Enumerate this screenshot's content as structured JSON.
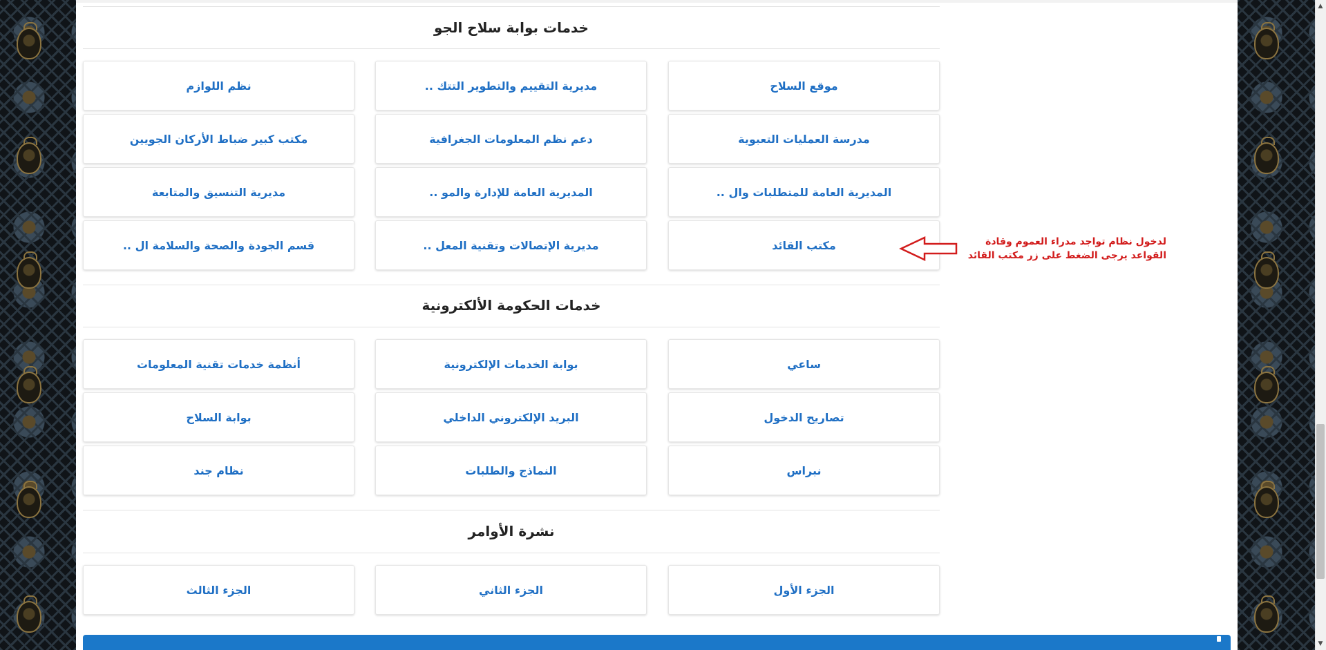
{
  "sections": [
    {
      "title": "خدمات بوابة سلاح الجو",
      "tiles": [
        "موقع السلاح",
        "مديرية التقييم والتطوير التتك ..",
        "نظم اللوازم",
        "مدرسة العمليات التعبوية",
        "دعم نظم المعلومات الجغرافية",
        "مكتب كبير ضباط الأركان الجويين",
        "المديرية العامة للمتطلبات وال ..",
        "المديرية العامة للإدارة والمو ..",
        "مديرية التنسيق والمتابعة",
        "مكتب القائد",
        "مديرية الإتصالات وتقنية المعل ..",
        "قسم الجودة والصحة والسلامة ال .."
      ]
    },
    {
      "title": "خدمات الحكومة الألكترونية",
      "tiles": [
        "ساعي",
        "بوابة الخدمات الإلكترونية",
        "أنظمة خدمات تقنية المعلومات",
        "تصاريح الدخول",
        "البريد الإلكتروني الداخلي",
        "بوابة السلاح",
        "نبراس",
        "النماذج والطلبات",
        "نظام جند"
      ]
    },
    {
      "title": "نشرة الأوامر",
      "tiles": [
        "الجزء الأول",
        "الجزء الثاني",
        "الجزء الثالث"
      ]
    }
  ],
  "annotation": {
    "line1": "لدخول نظام تواجد مدراء العموم وقادة",
    "line2": "القواعد يرجى الضغط على زر مكتب القائد"
  },
  "colors": {
    "link": "#1f6fc4",
    "annotation": "#d21c1c",
    "footer": "#1b78c9"
  }
}
